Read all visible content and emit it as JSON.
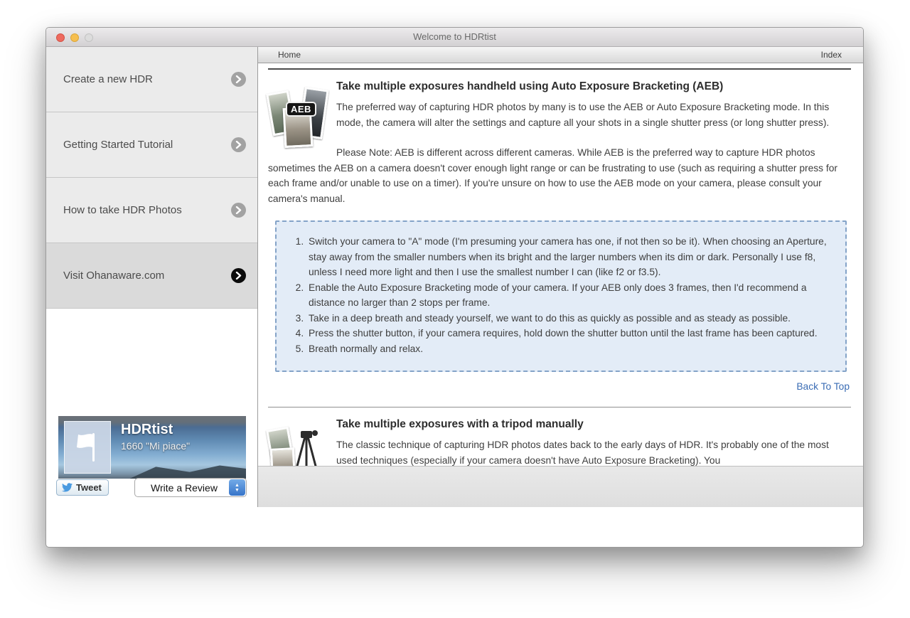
{
  "window": {
    "title": "Welcome to HDRtist"
  },
  "toolbar": {
    "home": "Home",
    "index": "Index"
  },
  "sidebar": {
    "items": [
      {
        "label": "Create a new HDR"
      },
      {
        "label": "Getting Started Tutorial"
      },
      {
        "label": "How to take HDR Photos"
      },
      {
        "label": "Visit Ohanaware.com"
      }
    ],
    "widget": {
      "title": "HDRtist",
      "likes": "1660 \"Mi piace\"",
      "tweet_label": "Tweet",
      "review_label": "Write a Review"
    }
  },
  "content": {
    "section1": {
      "icon_badge": "AEB",
      "heading": "Take multiple exposures handheld using Auto Exposure Bracketing (AEB)",
      "para1": "The preferred way of capturing HDR photos by many is to use the AEB or Auto Exposure Bracketing mode. In this mode, the camera will alter the settings and capture all your shots in a single shutter press (or long shutter press).",
      "para2": "Please Note: AEB is different across different cameras. While AEB is the preferred way to capture HDR photos sometimes the AEB on a camera doesn't cover enough light range or can be frustrating to use (such as requiring a shutter press for each frame and/or unable to use on a timer). If you're unsure on how to use the AEB mode on your camera, please consult your camera's manual.",
      "steps": [
        "Switch your camera to \"A\" mode (I'm presuming your camera has one, if not then so be it). When choosing an Aperture, stay away from the smaller numbers when its bright and the larger numbers when its dim or dark. Personally I use f8, unless I need more light and then I use the smallest number I can (like f2 or f3.5).",
        "Enable the Auto Exposure Bracketing mode of your camera. If your AEB only does 3 frames, then I'd recommend a distance no larger than 2 stops per frame.",
        "Take in a deep breath and steady yourself, we want to do this as quickly as possible and as steady as possible.",
        "Press the shutter button, if your camera requires, hold down the shutter button until the last frame has been captured.",
        "Breath normally and relax."
      ],
      "back_to_top": "Back To Top"
    },
    "section2": {
      "heading": "Take multiple exposures with a tripod manually",
      "para1": "The classic technique of capturing HDR photos dates back to the early days of HDR. It's probably one of the most used techniques (especially if your camera doesn't have Auto Exposure Bracketing). You"
    }
  },
  "colors": {
    "accent_link": "#3a6cb4",
    "steps_box_bg": "#e3ecf7",
    "steps_box_border": "#84a3c8",
    "selected_chevron": "#0b0b0b"
  }
}
